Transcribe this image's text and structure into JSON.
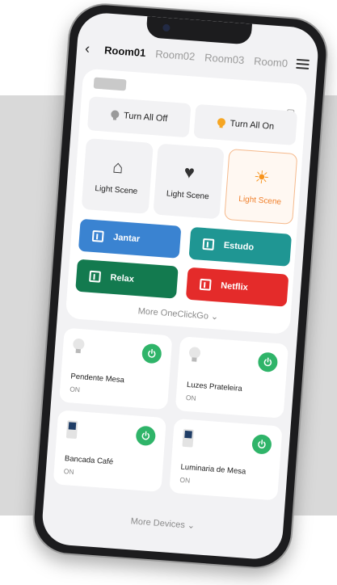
{
  "header": {
    "tabs": [
      {
        "label": "Room01"
      },
      {
        "label": "Room02"
      },
      {
        "label": "Room03"
      },
      {
        "label": "Room0"
      }
    ]
  },
  "controls": {
    "all_off_label": "Turn All Off",
    "all_on_label": "Turn All On"
  },
  "scenes": [
    {
      "label": "Light Scene",
      "icon": "home-person-icon"
    },
    {
      "label": "Light Scene",
      "icon": "heart-plant-icon"
    },
    {
      "label": "Light Scene",
      "icon": "sun-icon",
      "selected": true
    }
  ],
  "oneclickgo": {
    "items": [
      {
        "label": "Jantar",
        "color": "#3a83d1"
      },
      {
        "label": "Estudo",
        "color": "#1f9693"
      },
      {
        "label": "Relax",
        "color": "#137a4f"
      },
      {
        "label": "Netflix",
        "color": "#e42b2a"
      }
    ],
    "more_label": "More OneClickGo ⌄"
  },
  "devices": {
    "items": [
      {
        "name": "Pendente Mesa",
        "state": "ON",
        "icon": "bulb-icon"
      },
      {
        "name": "Luzes Prateleira",
        "state": "ON",
        "icon": "bulb-icon"
      },
      {
        "name": "Bancada Café",
        "state": "ON",
        "icon": "switch-icon"
      },
      {
        "name": "Luminaria de Mesa",
        "state": "ON",
        "icon": "switch-icon"
      }
    ],
    "more_label": "More Devices ⌄"
  },
  "colors": {
    "power_on": "#2fb469",
    "scene_selected": "#f07f2a"
  }
}
